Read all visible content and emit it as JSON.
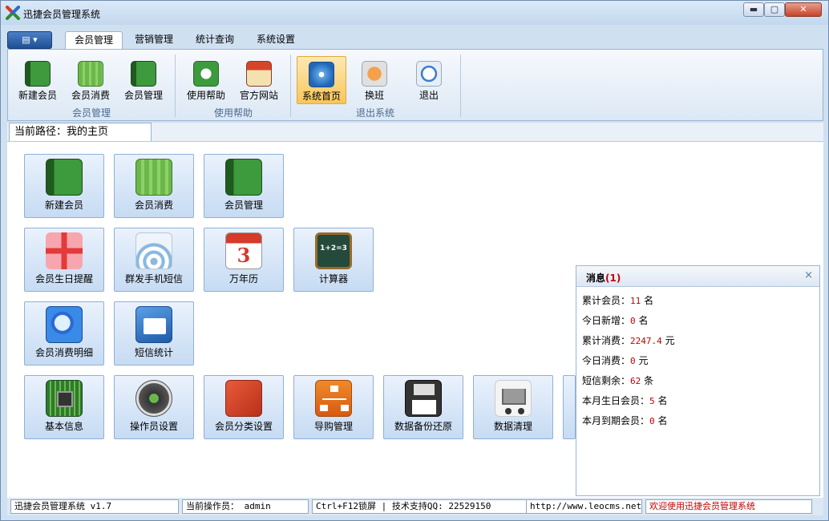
{
  "window": {
    "title": "迅捷会员管理系统",
    "min": "▬",
    "max": "▢",
    "close": "✕"
  },
  "menubar": {
    "appmenu": "▤ ▾",
    "tabs": [
      {
        "label": "会员管理"
      },
      {
        "label": "营销管理"
      },
      {
        "label": "统计查询"
      },
      {
        "label": "系统设置"
      }
    ]
  },
  "ribbon": {
    "buttons": [
      {
        "label": "新建会员",
        "icon": "member-book-icon"
      },
      {
        "label": "会员消费",
        "icon": "water-drop-icon"
      },
      {
        "label": "会员管理",
        "icon": "address-book-icon"
      },
      {
        "label": "使用帮助",
        "icon": "chat-bubble-icon"
      },
      {
        "label": "官方网站",
        "icon": "shop-icon"
      },
      {
        "label": "系统首页",
        "icon": "compass-icon"
      },
      {
        "label": "换班",
        "icon": "swap-icon"
      },
      {
        "label": "退出",
        "icon": "power-icon"
      }
    ],
    "groups": [
      "会员管理",
      "使用帮助",
      "退出系统"
    ]
  },
  "path": {
    "text": "当前路径：我的主页"
  },
  "tiles": [
    {
      "label": "新建会员"
    },
    {
      "label": "会员消费"
    },
    {
      "label": "会员管理"
    },
    {
      "label": "会员生日提醒"
    },
    {
      "label": "群发手机短信"
    },
    {
      "label": "万年历",
      "glyph": "3"
    },
    {
      "label": "计算器",
      "glyph": "1+2=3"
    },
    {
      "label": "会员消费明细"
    },
    {
      "label": "短信统计"
    },
    {
      "label": "基本信息"
    },
    {
      "label": "操作员设置"
    },
    {
      "label": "会员分类设置"
    },
    {
      "label": "导购管理"
    },
    {
      "label": "数据备份还原"
    },
    {
      "label": "数据清理"
    }
  ],
  "messages": {
    "title": "消息",
    "count": "(1)",
    "close": "×",
    "rows": [
      {
        "label": "累计会员：",
        "value": "11",
        "unit": "名"
      },
      {
        "label": "今日新增：",
        "value": "0",
        "unit": "名"
      },
      {
        "label": "累计消费：",
        "value": "2247.4",
        "unit": "元"
      },
      {
        "label": "今日消费：",
        "value": "0",
        "unit": "元"
      },
      {
        "label": "短信剩余：",
        "value": "62",
        "unit": "条"
      },
      {
        "label": "本月生日会员：",
        "value": "5",
        "unit": "名"
      },
      {
        "label": "本月到期会员：",
        "value": "0",
        "unit": "名"
      }
    ]
  },
  "status": {
    "app": "迅捷会员管理系统 v1.7",
    "operator": "当前操作员： admin",
    "shortcut": "Ctrl+F12锁屏 | 技术支持QQ:  22529150",
    "url": "http://www.leocms.net",
    "welcome": "欢迎使用迅捷会员管理系统"
  },
  "colors": {
    "accent": "#1e4f96",
    "highlight": "#f8c65a",
    "value_red": "#c00000"
  }
}
